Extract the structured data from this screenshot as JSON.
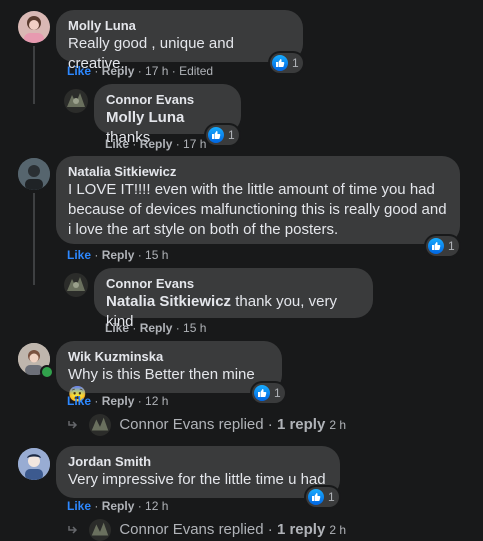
{
  "comments": [
    {
      "author": "Molly Luna",
      "text": "Really good , unique and creative.",
      "like": "Like",
      "reply": "Reply",
      "time": "17 h",
      "edited": "Edited",
      "reactions": "1"
    },
    {
      "author": "Connor Evans",
      "mention": "Molly Luna",
      "text": " thanks",
      "like": "Like",
      "reply": "Reply",
      "time": "17 h",
      "reactions": "1"
    },
    {
      "author": "Natalia Sitkiewicz",
      "lines": [
        "I LOVE IT!!!! even with the little amount of time you had",
        "because of devices malfunctioning this is really good and",
        "i love the art style on both of the posters."
      ],
      "like": "Like",
      "reply": "Reply",
      "time": "15 h",
      "reactions": "1"
    },
    {
      "author": "Connor Evans",
      "mention": "Natalia Sitkiewicz",
      "text": " thank you, very kind",
      "like": "Like",
      "reply": "Reply",
      "time": "15 h"
    },
    {
      "author": "Wik Kuzminska",
      "text": "Why is this Better then mine",
      "emoji": "😨",
      "like": "Like",
      "reply": "Reply",
      "time": "12 h",
      "reactions": "1",
      "replies_link": {
        "who": "Connor Evans replied",
        "count": "1 reply",
        "time": "2 h"
      }
    },
    {
      "author": "Jordan Smith",
      "text": "Very impressive for the little time u had",
      "like": "Like",
      "reply": "Reply",
      "time": "12 h",
      "reactions": "1",
      "replies_link": {
        "who": "Connor Evans replied",
        "count": "1 reply",
        "time": "2 h"
      }
    }
  ],
  "colors": {
    "background": "#18191a",
    "bubble": "#3a3b3c",
    "link": "#2d88ff",
    "muted": "#b0b3b8",
    "online": "#31a24c"
  },
  "icons": {
    "like": "thumbs-up-icon",
    "reply_arrow": "reply-arrow-icon"
  }
}
